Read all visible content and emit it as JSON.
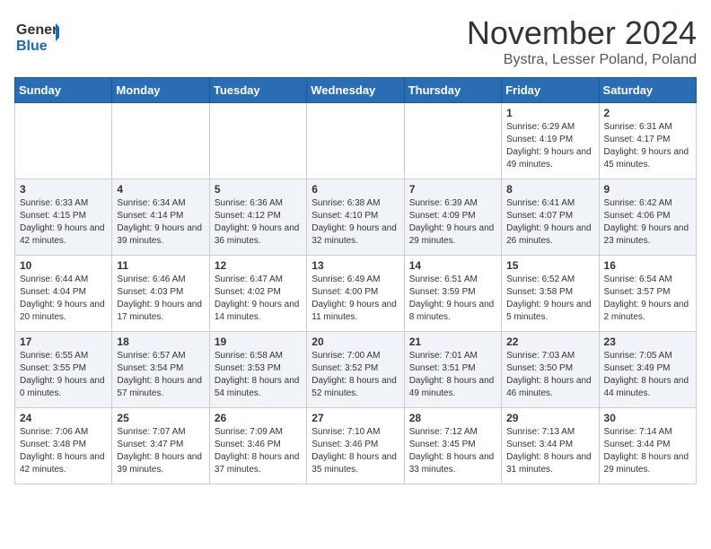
{
  "header": {
    "logo_general": "General",
    "logo_blue": "Blue",
    "month_title": "November 2024",
    "location": "Bystra, Lesser Poland, Poland"
  },
  "weekdays": [
    "Sunday",
    "Monday",
    "Tuesday",
    "Wednesday",
    "Thursday",
    "Friday",
    "Saturday"
  ],
  "weeks": [
    [
      {
        "day": "",
        "info": ""
      },
      {
        "day": "",
        "info": ""
      },
      {
        "day": "",
        "info": ""
      },
      {
        "day": "",
        "info": ""
      },
      {
        "day": "",
        "info": ""
      },
      {
        "day": "1",
        "info": "Sunrise: 6:29 AM\nSunset: 4:19 PM\nDaylight: 9 hours and 49 minutes."
      },
      {
        "day": "2",
        "info": "Sunrise: 6:31 AM\nSunset: 4:17 PM\nDaylight: 9 hours and 45 minutes."
      }
    ],
    [
      {
        "day": "3",
        "info": "Sunrise: 6:33 AM\nSunset: 4:15 PM\nDaylight: 9 hours and 42 minutes."
      },
      {
        "day": "4",
        "info": "Sunrise: 6:34 AM\nSunset: 4:14 PM\nDaylight: 9 hours and 39 minutes."
      },
      {
        "day": "5",
        "info": "Sunrise: 6:36 AM\nSunset: 4:12 PM\nDaylight: 9 hours and 36 minutes."
      },
      {
        "day": "6",
        "info": "Sunrise: 6:38 AM\nSunset: 4:10 PM\nDaylight: 9 hours and 32 minutes."
      },
      {
        "day": "7",
        "info": "Sunrise: 6:39 AM\nSunset: 4:09 PM\nDaylight: 9 hours and 29 minutes."
      },
      {
        "day": "8",
        "info": "Sunrise: 6:41 AM\nSunset: 4:07 PM\nDaylight: 9 hours and 26 minutes."
      },
      {
        "day": "9",
        "info": "Sunrise: 6:42 AM\nSunset: 4:06 PM\nDaylight: 9 hours and 23 minutes."
      }
    ],
    [
      {
        "day": "10",
        "info": "Sunrise: 6:44 AM\nSunset: 4:04 PM\nDaylight: 9 hours and 20 minutes."
      },
      {
        "day": "11",
        "info": "Sunrise: 6:46 AM\nSunset: 4:03 PM\nDaylight: 9 hours and 17 minutes."
      },
      {
        "day": "12",
        "info": "Sunrise: 6:47 AM\nSunset: 4:02 PM\nDaylight: 9 hours and 14 minutes."
      },
      {
        "day": "13",
        "info": "Sunrise: 6:49 AM\nSunset: 4:00 PM\nDaylight: 9 hours and 11 minutes."
      },
      {
        "day": "14",
        "info": "Sunrise: 6:51 AM\nSunset: 3:59 PM\nDaylight: 9 hours and 8 minutes."
      },
      {
        "day": "15",
        "info": "Sunrise: 6:52 AM\nSunset: 3:58 PM\nDaylight: 9 hours and 5 minutes."
      },
      {
        "day": "16",
        "info": "Sunrise: 6:54 AM\nSunset: 3:57 PM\nDaylight: 9 hours and 2 minutes."
      }
    ],
    [
      {
        "day": "17",
        "info": "Sunrise: 6:55 AM\nSunset: 3:55 PM\nDaylight: 9 hours and 0 minutes."
      },
      {
        "day": "18",
        "info": "Sunrise: 6:57 AM\nSunset: 3:54 PM\nDaylight: 8 hours and 57 minutes."
      },
      {
        "day": "19",
        "info": "Sunrise: 6:58 AM\nSunset: 3:53 PM\nDaylight: 8 hours and 54 minutes."
      },
      {
        "day": "20",
        "info": "Sunrise: 7:00 AM\nSunset: 3:52 PM\nDaylight: 8 hours and 52 minutes."
      },
      {
        "day": "21",
        "info": "Sunrise: 7:01 AM\nSunset: 3:51 PM\nDaylight: 8 hours and 49 minutes."
      },
      {
        "day": "22",
        "info": "Sunrise: 7:03 AM\nSunset: 3:50 PM\nDaylight: 8 hours and 46 minutes."
      },
      {
        "day": "23",
        "info": "Sunrise: 7:05 AM\nSunset: 3:49 PM\nDaylight: 8 hours and 44 minutes."
      }
    ],
    [
      {
        "day": "24",
        "info": "Sunrise: 7:06 AM\nSunset: 3:48 PM\nDaylight: 8 hours and 42 minutes."
      },
      {
        "day": "25",
        "info": "Sunrise: 7:07 AM\nSunset: 3:47 PM\nDaylight: 8 hours and 39 minutes."
      },
      {
        "day": "26",
        "info": "Sunrise: 7:09 AM\nSunset: 3:46 PM\nDaylight: 8 hours and 37 minutes."
      },
      {
        "day": "27",
        "info": "Sunrise: 7:10 AM\nSunset: 3:46 PM\nDaylight: 8 hours and 35 minutes."
      },
      {
        "day": "28",
        "info": "Sunrise: 7:12 AM\nSunset: 3:45 PM\nDaylight: 8 hours and 33 minutes."
      },
      {
        "day": "29",
        "info": "Sunrise: 7:13 AM\nSunset: 3:44 PM\nDaylight: 8 hours and 31 minutes."
      },
      {
        "day": "30",
        "info": "Sunrise: 7:14 AM\nSunset: 3:44 PM\nDaylight: 8 hours and 29 minutes."
      }
    ]
  ]
}
